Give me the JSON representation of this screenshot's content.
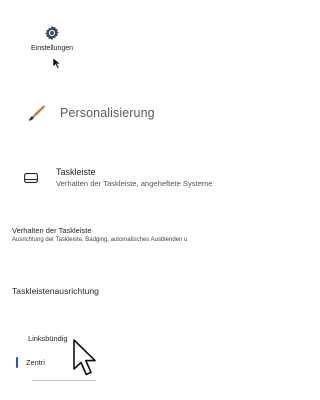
{
  "settings_app": {
    "label": "Einstellungen",
    "icon": "gear-icon"
  },
  "personalization": {
    "title": "Personalisierung",
    "icon": "brush-icon"
  },
  "taskbar": {
    "title": "Taskleiste",
    "subtitle": "Verhalten der Taskleiste, angeheftete Systeme",
    "icon": "taskbar-icon"
  },
  "behavior": {
    "title": "Verhalten der Taskleiste",
    "subtitle": "Ausrichtung der Taskleiste, Badging, automatisches Ausblenden u"
  },
  "alignment": {
    "title": "Taskleistenausrichtung",
    "options": [
      {
        "label": "Linksbündig",
        "selected": false
      },
      {
        "label": "Zentri",
        "selected": true
      }
    ]
  },
  "colors": {
    "accent": "#1a5fb4",
    "brush_handle": "#c8722a",
    "brush_tip": "#3a3a3a"
  }
}
